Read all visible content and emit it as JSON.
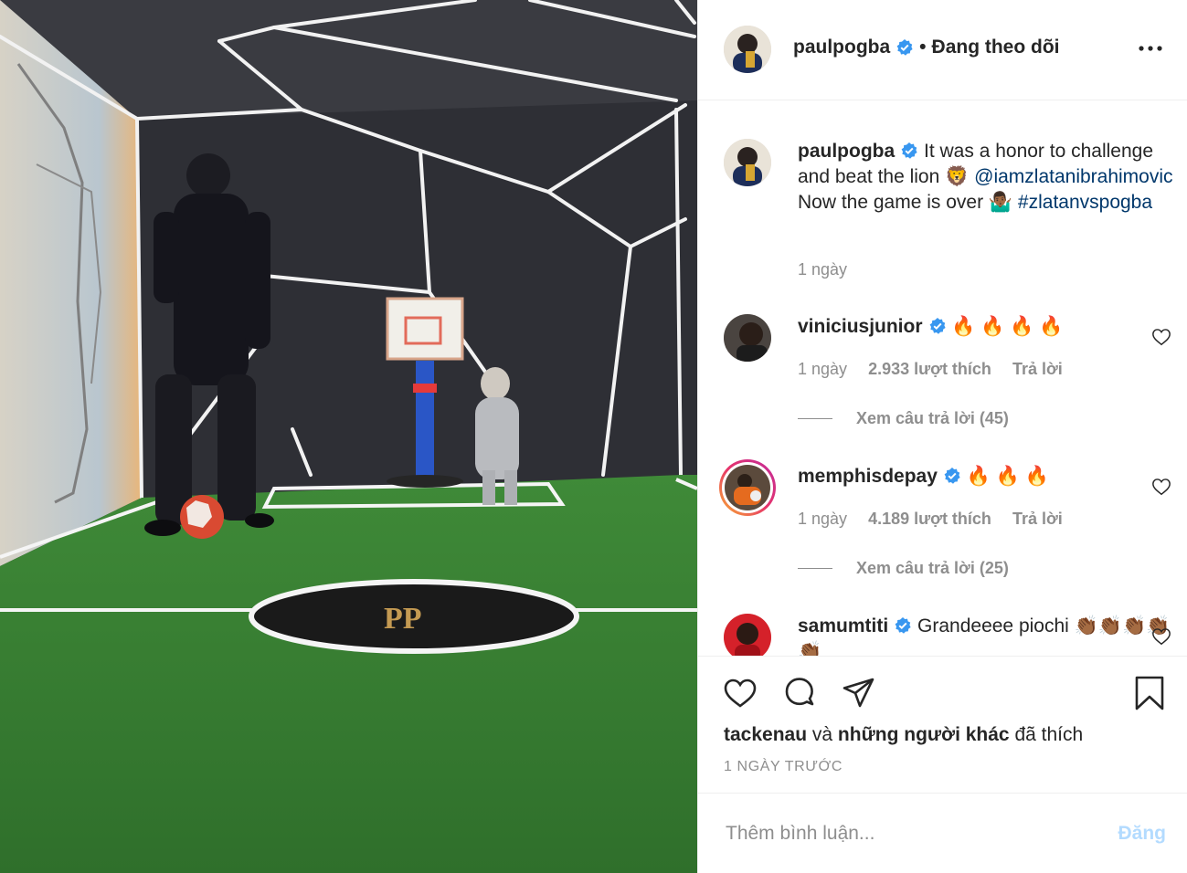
{
  "header": {
    "username": "paulpogba",
    "separator": "•",
    "follow_status": "Đang theo dõi"
  },
  "caption": {
    "username": "paulpogba",
    "text_1": "It was a honor to challenge and beat the lion 🦁",
    "mention": "@iamzlatanibrahimovic",
    "text_2": "Now the game is over 🤷🏾‍♂️",
    "hashtag": "#zlatanvspogba",
    "time": "1 ngày"
  },
  "comments": [
    {
      "username": "viniciusjunior",
      "text": "🔥 🔥 🔥 🔥",
      "time": "1 ngày",
      "likes": "2.933 lượt thích",
      "reply": "Trả lời",
      "view_replies": "Xem câu trả lời (45)"
    },
    {
      "username": "memphisdepay",
      "text": "🔥 🔥 🔥",
      "time": "1 ngày",
      "likes": "4.189 lượt thích",
      "reply": "Trả lời",
      "view_replies": "Xem câu trả lời (25)"
    },
    {
      "username": "samumtiti",
      "text": "Grandeeee piochi 👏🏾👏🏾👏🏾👏🏾👏🏾"
    }
  ],
  "actions": {
    "icons": [
      "heart-icon",
      "comment-icon",
      "share-icon",
      "bookmark-icon"
    ],
    "liked_by_user": "tackenau",
    "liked_by_joiner": "và",
    "liked_by_others": "những người khác",
    "liked_suffix": "đã thích",
    "time_ago": "1 NGÀY TRƯỚC"
  },
  "add_comment": {
    "placeholder": "Thêm bình luận...",
    "post_label": "Đăng"
  },
  "colors": {
    "link": "#00376b",
    "verified": "#3897f0",
    "muted": "#8e8e8e",
    "post_disabled": "#b3dbff"
  }
}
